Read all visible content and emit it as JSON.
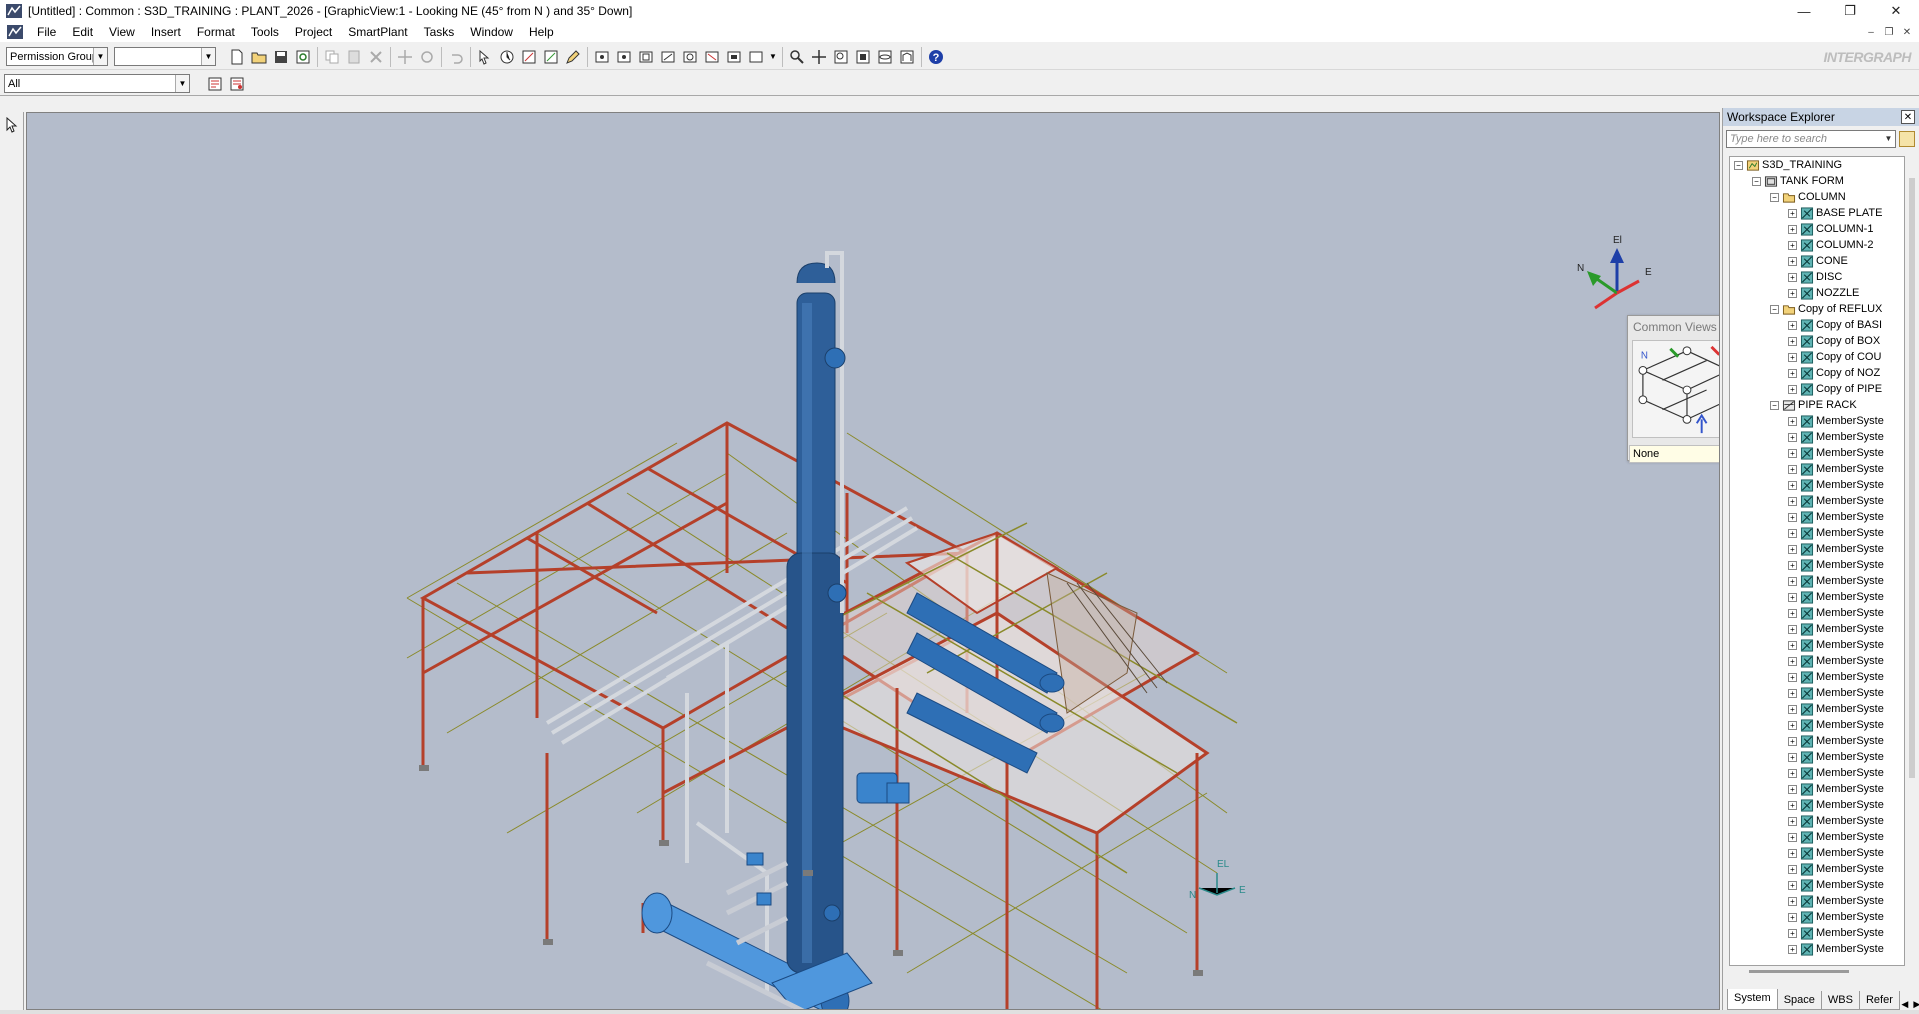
{
  "window": {
    "title": "[Untitled] : Common : S3D_TRAINING : PLANT_2026 - [GraphicView:1 - Looking NE (45° from N ) and 35° Down]",
    "minimize": "—",
    "maximize": "❐",
    "close": "✕"
  },
  "menu": [
    "File",
    "Edit",
    "View",
    "Insert",
    "Format",
    "Tools",
    "Project",
    "SmartPlant",
    "Tasks",
    "Window",
    "Help"
  ],
  "mdi_controls": [
    "–",
    "❐",
    "✕"
  ],
  "toolbar": {
    "permission_group": "Permission Group",
    "blank_combo": "",
    "logo": "INTERGRAPH"
  },
  "filter": {
    "value": "All"
  },
  "common_views": {
    "title": "Common Views",
    "status": "None",
    "n_label": "N"
  },
  "compass": {
    "el": "El",
    "n": "N",
    "e": "E"
  },
  "ground_compass": {
    "el": "EL",
    "n": "N",
    "e": "E"
  },
  "workspace": {
    "title": "Workspace Explorer",
    "search_placeholder": "Type here to search",
    "tabs": [
      "System",
      "Space",
      "WBS",
      "Refer"
    ],
    "tree": [
      {
        "level": 0,
        "exp": "−",
        "label": "S3D_TRAINING",
        "icon": "plant-icon"
      },
      {
        "level": 1,
        "exp": "−",
        "label": "TANK FORM",
        "icon": "system-icon"
      },
      {
        "level": 2,
        "exp": "−",
        "label": "COLUMN",
        "icon": "folder-icon"
      },
      {
        "level": 3,
        "exp": "+",
        "label": "BASE PLATE",
        "icon": "member-icon"
      },
      {
        "level": 3,
        "exp": "+",
        "label": "COLUMN-1",
        "icon": "member-icon"
      },
      {
        "level": 3,
        "exp": "+",
        "label": "COLUMN-2",
        "icon": "member-icon"
      },
      {
        "level": 3,
        "exp": "+",
        "label": "CONE",
        "icon": "member-icon"
      },
      {
        "level": 3,
        "exp": "+",
        "label": "DISC",
        "icon": "member-icon"
      },
      {
        "level": 3,
        "exp": "+",
        "label": "NOZZLE",
        "icon": "member-icon"
      },
      {
        "level": 2,
        "exp": "−",
        "label": "Copy of REFLUX",
        "icon": "folder-icon"
      },
      {
        "level": 3,
        "exp": "+",
        "label": "Copy of BASI",
        "icon": "member-icon"
      },
      {
        "level": 3,
        "exp": "+",
        "label": "Copy of BOX",
        "icon": "member-icon"
      },
      {
        "level": 3,
        "exp": "+",
        "label": "Copy of COU",
        "icon": "member-icon"
      },
      {
        "level": 3,
        "exp": "+",
        "label": "Copy of NOZ",
        "icon": "member-icon"
      },
      {
        "level": 3,
        "exp": "+",
        "label": "Copy of PIPE",
        "icon": "member-icon"
      },
      {
        "level": 2,
        "exp": "−",
        "label": "PIPE RACK",
        "icon": "rack-icon"
      },
      {
        "level": 3,
        "exp": "+",
        "label": "MemberSyste",
        "icon": "member-icon"
      },
      {
        "level": 3,
        "exp": "+",
        "label": "MemberSyste",
        "icon": "member-icon"
      },
      {
        "level": 3,
        "exp": "+",
        "label": "MemberSyste",
        "icon": "member-icon"
      },
      {
        "level": 3,
        "exp": "+",
        "label": "MemberSyste",
        "icon": "member-icon"
      },
      {
        "level": 3,
        "exp": "+",
        "label": "MemberSyste",
        "icon": "member-icon"
      },
      {
        "level": 3,
        "exp": "+",
        "label": "MemberSyste",
        "icon": "member-icon"
      },
      {
        "level": 3,
        "exp": "+",
        "label": "MemberSyste",
        "icon": "member-icon"
      },
      {
        "level": 3,
        "exp": "+",
        "label": "MemberSyste",
        "icon": "member-icon"
      },
      {
        "level": 3,
        "exp": "+",
        "label": "MemberSyste",
        "icon": "member-icon"
      },
      {
        "level": 3,
        "exp": "+",
        "label": "MemberSyste",
        "icon": "member-icon"
      },
      {
        "level": 3,
        "exp": "+",
        "label": "MemberSyste",
        "icon": "member-icon"
      },
      {
        "level": 3,
        "exp": "+",
        "label": "MemberSyste",
        "icon": "member-icon"
      },
      {
        "level": 3,
        "exp": "+",
        "label": "MemberSyste",
        "icon": "member-icon"
      },
      {
        "level": 3,
        "exp": "+",
        "label": "MemberSyste",
        "icon": "member-icon"
      },
      {
        "level": 3,
        "exp": "+",
        "label": "MemberSyste",
        "icon": "member-icon"
      },
      {
        "level": 3,
        "exp": "+",
        "label": "MemberSyste",
        "icon": "member-icon"
      },
      {
        "level": 3,
        "exp": "+",
        "label": "MemberSyste",
        "icon": "member-icon"
      },
      {
        "level": 3,
        "exp": "+",
        "label": "MemberSyste",
        "icon": "member-icon"
      },
      {
        "level": 3,
        "exp": "+",
        "label": "MemberSyste",
        "icon": "member-icon"
      },
      {
        "level": 3,
        "exp": "+",
        "label": "MemberSyste",
        "icon": "member-icon"
      },
      {
        "level": 3,
        "exp": "+",
        "label": "MemberSyste",
        "icon": "member-icon"
      },
      {
        "level": 3,
        "exp": "+",
        "label": "MemberSyste",
        "icon": "member-icon"
      },
      {
        "level": 3,
        "exp": "+",
        "label": "MemberSyste",
        "icon": "member-icon"
      },
      {
        "level": 3,
        "exp": "+",
        "label": "MemberSyste",
        "icon": "member-icon"
      },
      {
        "level": 3,
        "exp": "+",
        "label": "MemberSyste",
        "icon": "member-icon"
      },
      {
        "level": 3,
        "exp": "+",
        "label": "MemberSyste",
        "icon": "member-icon"
      },
      {
        "level": 3,
        "exp": "+",
        "label": "MemberSyste",
        "icon": "member-icon"
      },
      {
        "level": 3,
        "exp": "+",
        "label": "MemberSyste",
        "icon": "member-icon"
      },
      {
        "level": 3,
        "exp": "+",
        "label": "MemberSyste",
        "icon": "member-icon"
      },
      {
        "level": 3,
        "exp": "+",
        "label": "MemberSyste",
        "icon": "member-icon"
      },
      {
        "level": 3,
        "exp": "+",
        "label": "MemberSyste",
        "icon": "member-icon"
      },
      {
        "level": 3,
        "exp": "+",
        "label": "MemberSyste",
        "icon": "member-icon"
      },
      {
        "level": 3,
        "exp": "+",
        "label": "MemberSyste",
        "icon": "member-icon"
      },
      {
        "level": 3,
        "exp": "+",
        "label": "MemberSyste",
        "icon": "member-icon"
      }
    ]
  },
  "colors": {
    "viewport_bg": "#b4bccb",
    "steel_red": "#b5402a",
    "grid_olive": "#8a8a2a",
    "equipment_blue": "#2e6fb5",
    "pipe_grey": "#c8ccd4"
  }
}
